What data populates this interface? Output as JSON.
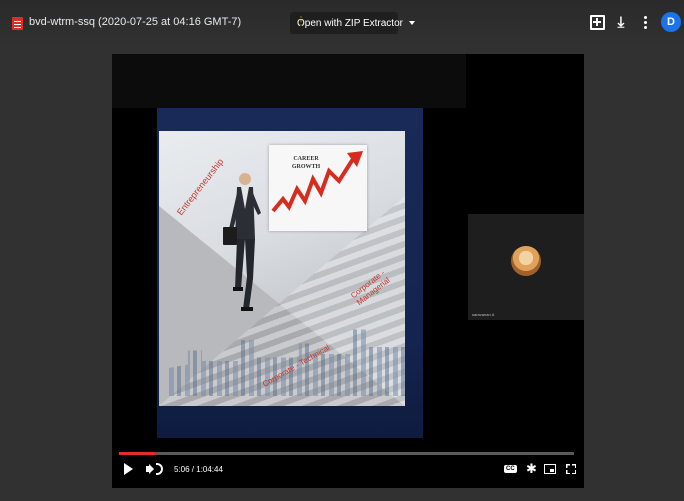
{
  "header": {
    "file_title": "bvd-wtrm-ssq (2020-07-25 at 04:16 GMT-7)",
    "open_with_label": "Open with ZIP Extractor",
    "avatar_letter": "D",
    "icons": [
      "video-file-icon",
      "zip-extractor-icon",
      "add-to-drive-icon",
      "download-icon",
      "more-vert-icon"
    ]
  },
  "slide": {
    "card_text": "CAREER GROWTH",
    "label_entrepreneurship": "Entrepreneurship",
    "label_corporate_managerial": "Corporate - Managerial",
    "label_corporate_technical": "Corporate - Technical"
  },
  "participant": {
    "name": "saravanan A"
  },
  "player": {
    "progress": 0.08,
    "time_display": "5:06 / 1:04:44",
    "cc_label": "CC",
    "accent_color": "#e52d27"
  }
}
